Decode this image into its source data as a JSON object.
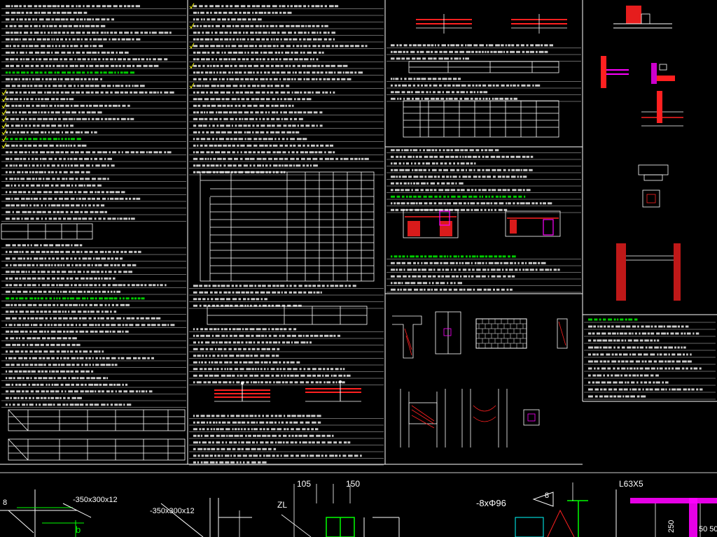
{
  "drawing": {
    "dimension_labels": {
      "dim_105": "105",
      "dim_150": "150",
      "plate_left": "-350x300x12",
      "plate_mid": "-350x300x12",
      "rebar": "-8xΦ96",
      "angle_steel": "L63X5",
      "beam_tag": "ZL",
      "dim_250": "250",
      "dim_50_50": "50 50",
      "section_b": "b",
      "count_8_left": "8",
      "count_8_right": "8"
    }
  },
  "colors": {
    "background": "#000000",
    "frame": "#ffffff",
    "note_text": "#ffffff",
    "highlight_green": "#00ff00",
    "rebar_red": "#ff2020",
    "hatch_magenta": "#ff00ff",
    "cyan": "#00ffff",
    "yellow": "#ffff00"
  },
  "icons": [
    "check-mark-icon"
  ]
}
